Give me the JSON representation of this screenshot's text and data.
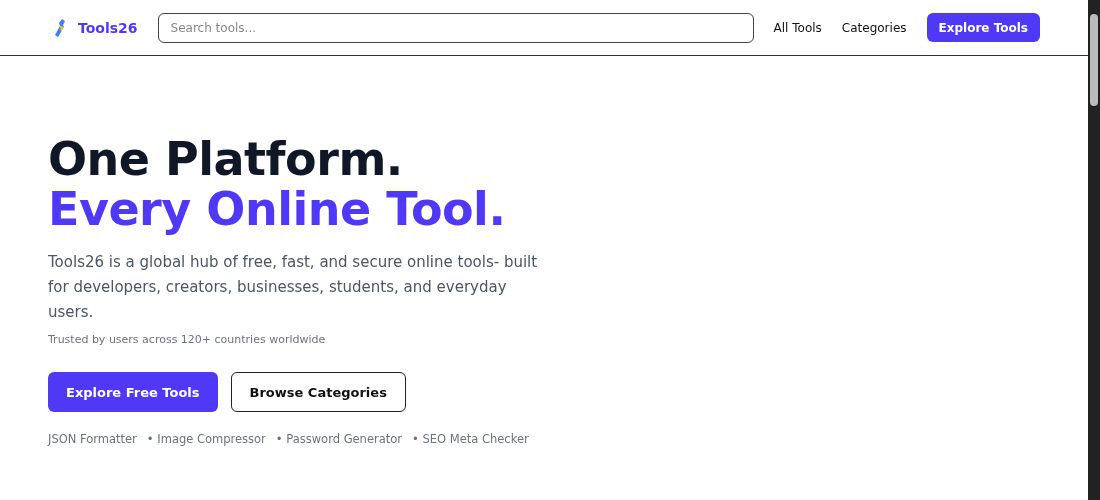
{
  "header": {
    "brand": "Tools26",
    "search": {
      "placeholder": "Search tools..."
    },
    "nav": [
      "All Tools",
      "Categories"
    ],
    "cta": "Explore Tools"
  },
  "hero": {
    "title_line_1": "One Platform.",
    "title_line_2": "Every Online Tool.",
    "description": "Tools26 is a global hub of free, fast, and secure online tools- built for developers, creators, businesses, students, and everyday users.",
    "trust": "Trusted by users across 120+ countries worldwide",
    "buttons": [
      {
        "label": "Explore Free Tools",
        "kind": "primary"
      },
      {
        "label": "Browse Categories",
        "kind": "outline"
      }
    ],
    "popular": [
      "JSON Formatter",
      "• Image Compressor",
      "• Password Generator",
      "• SEO Meta Checker"
    ]
  }
}
